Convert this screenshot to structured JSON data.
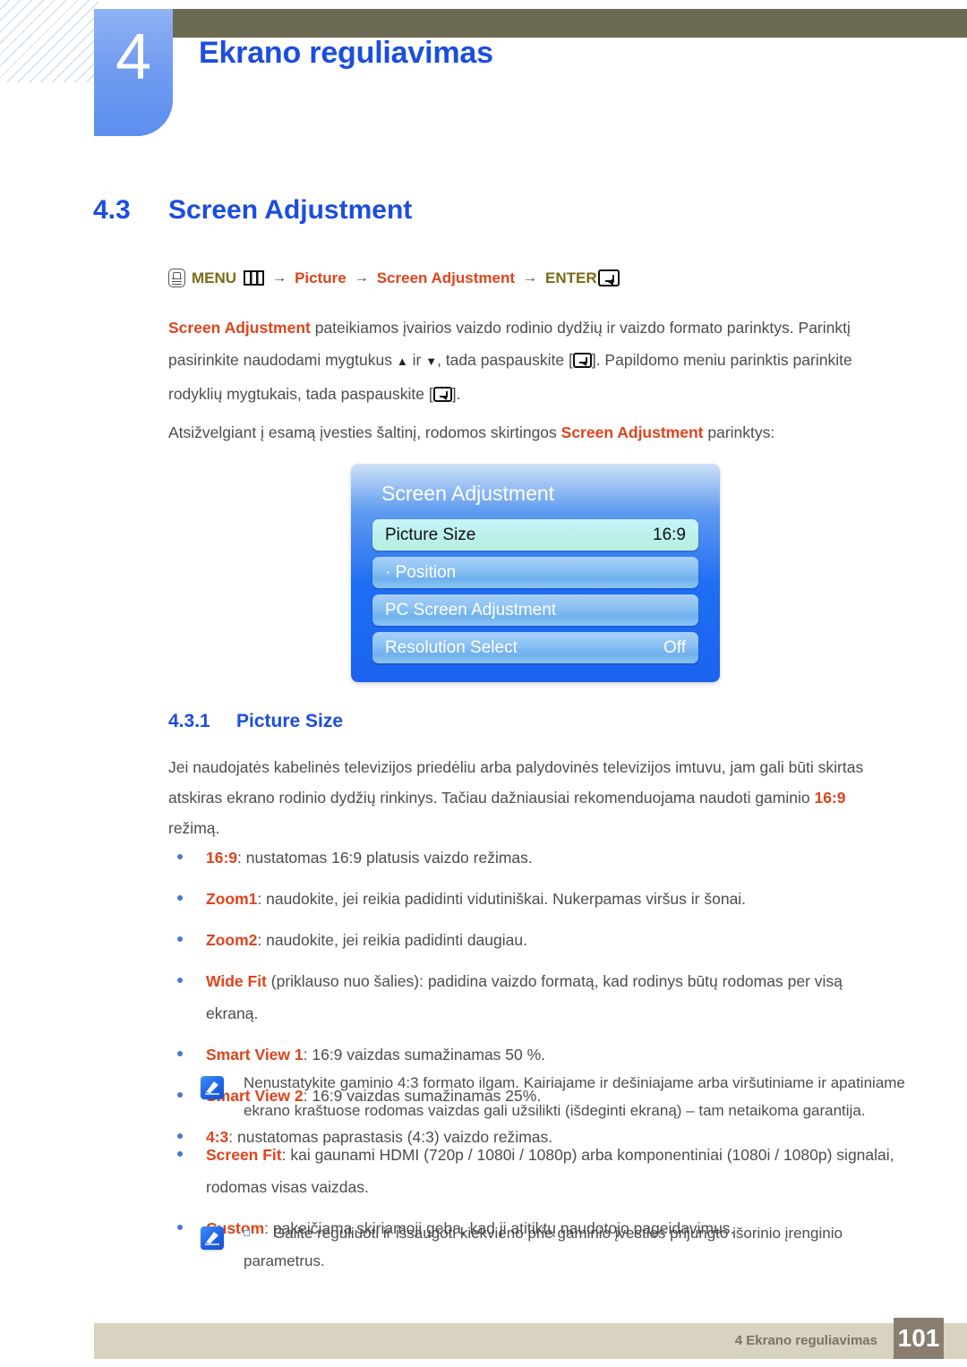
{
  "chapter": {
    "number": "4",
    "title": "Ekrano reguliavimas"
  },
  "section": {
    "number": "4.3",
    "title": "Screen Adjustment"
  },
  "breadcrumb": {
    "menu_label": "MENU",
    "arrow": "→",
    "item1": "Picture",
    "item2": "Screen Adjustment",
    "enter_label": "ENTER",
    "hand_icon": "hand-pointer-icon",
    "menu_icon": "menu-bars-icon",
    "enter_icon": "enter-key-icon"
  },
  "intro": {
    "p1_kw": "Screen Adjustment",
    "p1_a": " pateikiamos įvairios vaizdo rodinio dydžių ir vaizdo formato parinktys. Parinktį pasirinkite naudodami mygtukus ",
    "p1_up": "▲",
    "p1_b": " ir ",
    "p1_down": "▼",
    "p1_c": ", tada paspauskite [",
    "p1_d": "]. Papildomo meniu parinktis parinkite rodyklių mygtukais, tada paspauskite [",
    "p1_e": "].",
    "p2_a": "Atsižvelgiant į esamą įvesties šaltinį, rodomos skirtingos ",
    "p2_kw": "Screen Adjustment",
    "p2_b": " parinktys:"
  },
  "osd": {
    "title": "Screen Adjustment",
    "rows": [
      {
        "label": "Picture Size",
        "value": "16:9",
        "active": true
      },
      {
        "label": "· Position",
        "value": "",
        "active": false
      },
      {
        "label": "PC Screen Adjustment",
        "value": "",
        "active": false
      },
      {
        "label": "Resolution Select",
        "value": "Off",
        "active": false
      }
    ]
  },
  "subsection": {
    "number": "4.3.1",
    "title": "Picture Size"
  },
  "picture_size_intro": {
    "a": "Jei naudojatės kabelinės televizijos priedėliu arba palydovinės televizijos imtuvu, jam gali būti skirtas atskiras ekrano rodinio dydžių rinkinys. Tačiau dažniausiai rekomenduojama naudoti gaminio ",
    "kw": "16:9",
    "b": " režimą."
  },
  "bullets": [
    {
      "kw": "16:9",
      "rest": ": nustatomas 16:9 platusis vaizdo režimas."
    },
    {
      "kw": "Zoom1",
      "rest": ": naudokite, jei reikia padidinti vidutiniškai. Nukerpamas viršus ir šonai."
    },
    {
      "kw": "Zoom2",
      "rest": ": naudokite, jei reikia padidinti daugiau."
    },
    {
      "kw": "Wide Fit",
      "rest": " (priklauso nuo šalies): padidina vaizdo formatą, kad rodinys būtų rodomas per visą ekraną."
    },
    {
      "kw": "Smart View 1",
      "rest": ": 16:9 vaizdas sumažinamas 50 %."
    },
    {
      "kw": "Smart View 2",
      "rest": ": 16:9 vaizdas sumažinamas 25%."
    },
    {
      "kw": "4:3",
      "rest": ": nustatomas paprastasis (4:3) vaizdo režimas."
    }
  ],
  "note1": {
    "icon": "note-pen-icon",
    "text": "Nenustatykite gaminio 4:3 formato ilgam. Kairiajame ir dešiniajame arba viršutiniame ir apatiniame ekrano kraštuose rodomas vaizdas gali užsilikti (išdeginti ekraną) – tam netaikoma garantija."
  },
  "bullets2": [
    {
      "kw": "Screen Fit",
      "rest": ": kai gaunami HDMI (720p / 1080i / 1080p) arba komponentiniai (1080i / 1080p) signalai, rodomas visas vaizdas."
    },
    {
      "kw": "Custom",
      "rest": ": pakeičiama skiriamoji geba, kad ji atitiktų naudotojo pageidavimus."
    }
  ],
  "note2": {
    "icon": "note-pen-icon",
    "text": "Galite reguliuoti ir išsaugoti kiekvieno prie gaminio įvesties prijungto išorinio įrenginio parametrus."
  },
  "footer": {
    "text": "4 Ekrano reguliavimas",
    "page": "101"
  }
}
